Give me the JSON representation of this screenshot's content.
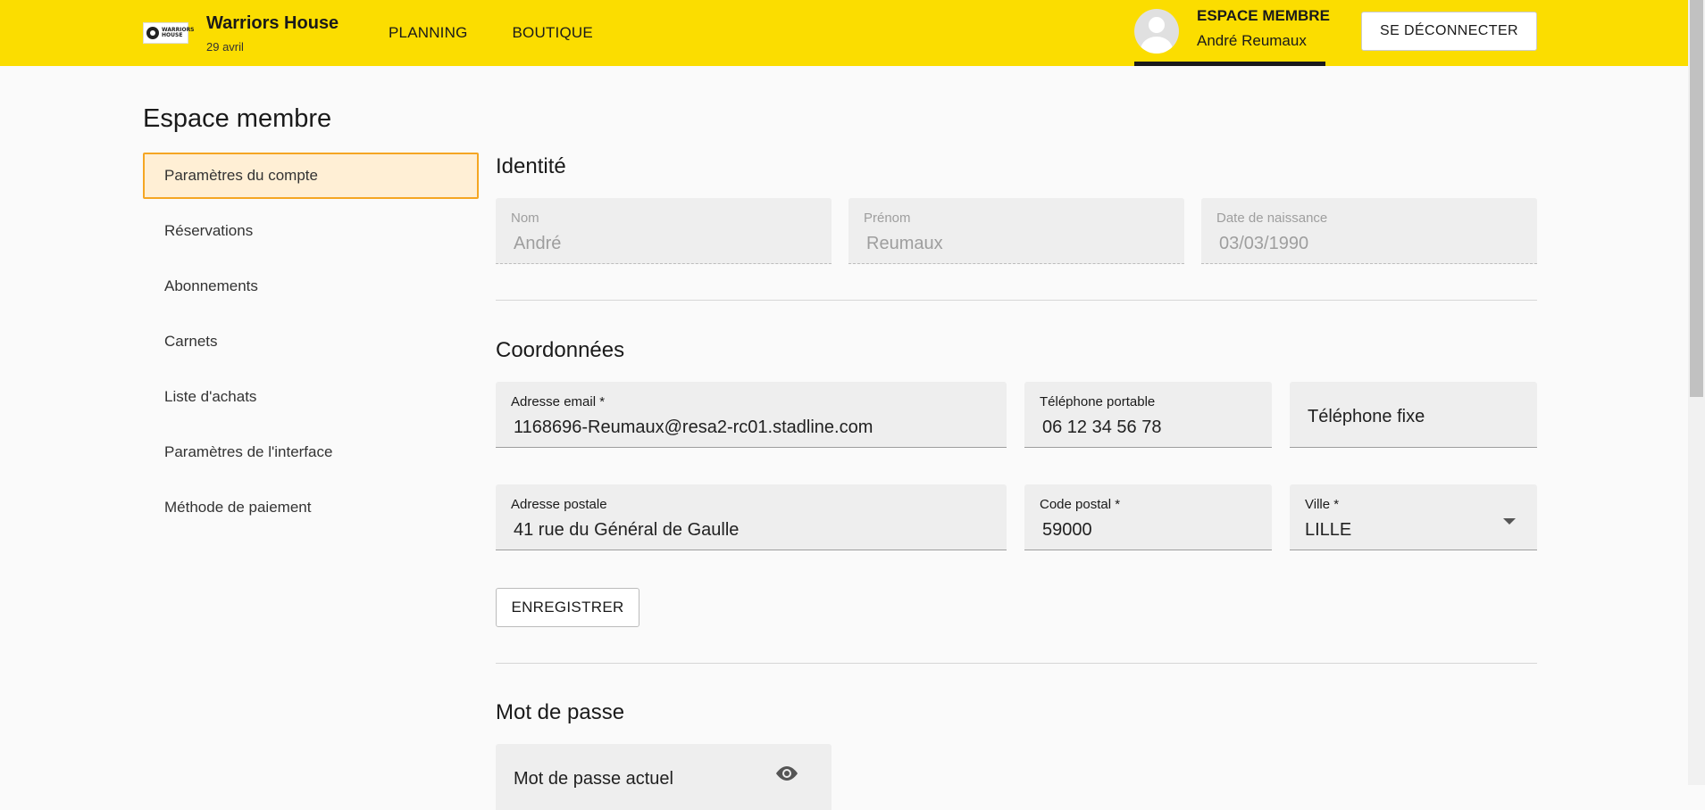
{
  "header": {
    "logo_text": "WARRIORS HOUSE",
    "brand_name": "Warriors House",
    "date": "29 avril",
    "nav": [
      {
        "label": "PLANNING"
      },
      {
        "label": "BOUTIQUE"
      }
    ],
    "member_title": "ESPACE MEMBRE",
    "member_name": "André Reumaux",
    "logout_label": "SE DÉCONNECTER"
  },
  "page": {
    "title": "Espace membre"
  },
  "sidebar": {
    "items": [
      {
        "label": "Paramètres du compte",
        "active": true
      },
      {
        "label": "Réservations"
      },
      {
        "label": "Abonnements"
      },
      {
        "label": "Carnets"
      },
      {
        "label": "Liste d'achats"
      },
      {
        "label": "Paramètres de l'interface"
      },
      {
        "label": "Méthode de paiement"
      }
    ]
  },
  "identity": {
    "title": "Identité",
    "nom": {
      "label": "Nom",
      "value": "André"
    },
    "prenom": {
      "label": "Prénom",
      "value": "Reumaux"
    },
    "naissance": {
      "label": "Date de naissance",
      "value": "03/03/1990"
    }
  },
  "coords": {
    "title": "Coordonnées",
    "email": {
      "label": "Adresse email *",
      "value": "1168696-Reumaux@resa2-rc01.stadline.com"
    },
    "mobile": {
      "label": "Téléphone portable",
      "value": "06 12 34 56 78"
    },
    "fixe": {
      "placeholder": "Téléphone fixe"
    },
    "adresse": {
      "label": "Adresse postale",
      "value": "41 rue du Général de Gaulle"
    },
    "cp": {
      "label": "Code postal *",
      "value": "59000"
    },
    "ville": {
      "label": "Ville *",
      "value": "LILLE"
    },
    "save_label": "ENREGISTRER"
  },
  "password": {
    "title": "Mot de passe",
    "current": {
      "placeholder": "Mot de passe actuel"
    }
  },
  "colors": {
    "header_bg": "#fbdd00",
    "active_bg": "#ffefd5",
    "active_border": "#f5a623"
  }
}
